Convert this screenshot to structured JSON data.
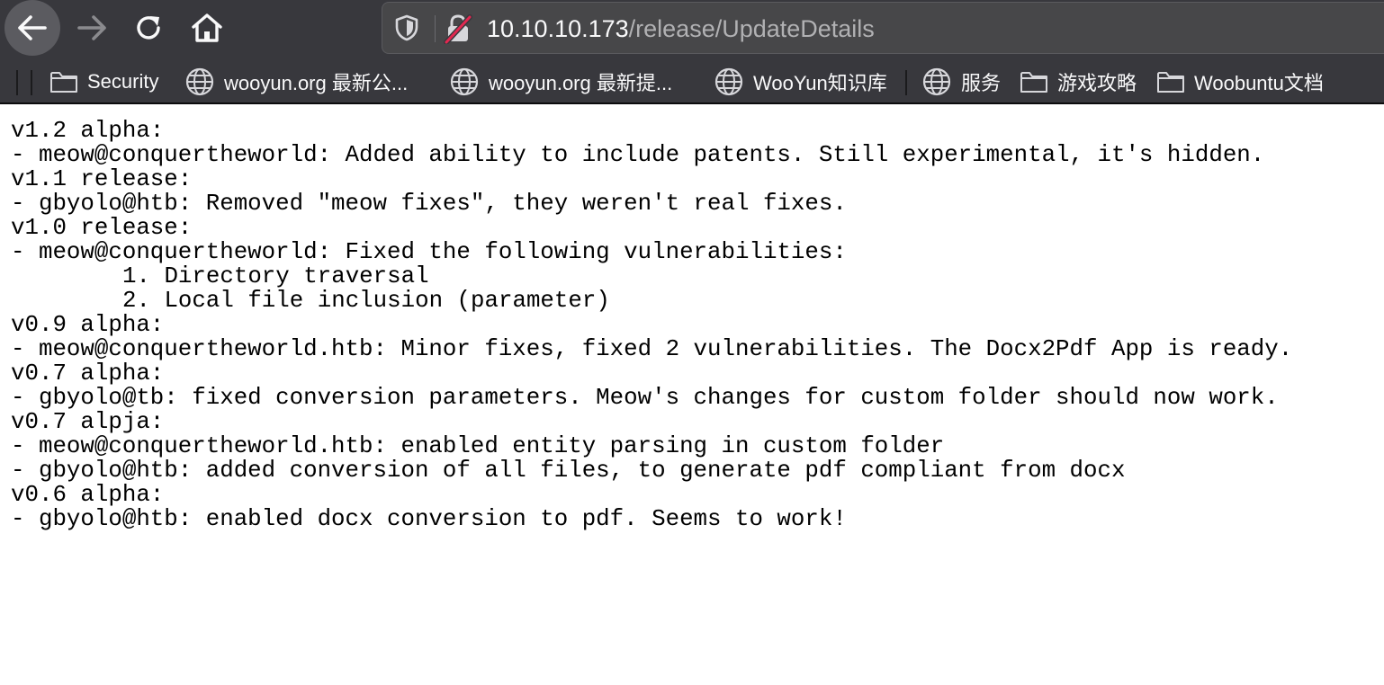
{
  "browser": {
    "nav": {
      "back_icon": "arrow-left-icon",
      "forward_icon": "arrow-right-icon",
      "reload_icon": "reload-icon",
      "home_icon": "home-icon"
    },
    "urlbar": {
      "host": "10.10.10.173",
      "path": "/release/UpdateDetails",
      "shield_icon": "tracking-protection-shield-icon",
      "lock_icon": "insecure-lock-icon"
    },
    "bookmarks": [
      {
        "label": "Security",
        "icon": "folder-icon"
      },
      {
        "label": "wooyun.org 最新公...",
        "icon": "globe-icon"
      },
      {
        "label": "wooyun.org 最新提...",
        "icon": "globe-icon"
      },
      {
        "label": "WooYun知识库",
        "icon": "globe-icon"
      },
      {
        "label": "服务",
        "icon": "globe-icon"
      },
      {
        "label": "游戏攻略",
        "icon": "folder-icon"
      },
      {
        "label": "Woobuntu文档",
        "icon": "folder-icon"
      }
    ],
    "colors": {
      "toolbar_bg": "#38383d",
      "urlbar_bg": "#474749",
      "host_text": "#f9f9fa",
      "path_text": "#b1b1b3",
      "insecure_red": "#e22850"
    }
  },
  "page": {
    "lines": [
      "v1.2 alpha:",
      "- meow@conquertheworld: Added ability to include patents. Still experimental, it's hidden.",
      "v1.1 release:",
      "- gbyolo@htb: Removed \"meow fixes\", they weren't real fixes.",
      "v1.0 release:",
      "- meow@conquertheworld: Fixed the following vulnerabilities:",
      "1. Directory traversal",
      "2. Local file inclusion (parameter)",
      "v0.9 alpha:",
      "- meow@conquertheworld.htb: Minor fixes, fixed 2 vulnerabilities. The Docx2Pdf App is ready.",
      "v0.7 alpha:",
      "- gbyolo@tb: fixed conversion parameters. Meow's changes for custom folder should now work.",
      "v0.7 alpja:",
      "- meow@conquertheworld.htb: enabled entity parsing in custom folder",
      "- gbyolo@htb: added conversion of all files, to generate pdf compliant from docx",
      "v0.6 alpha:",
      "- gbyolo@htb: enabled docx conversion to pdf. Seems to work!"
    ]
  }
}
